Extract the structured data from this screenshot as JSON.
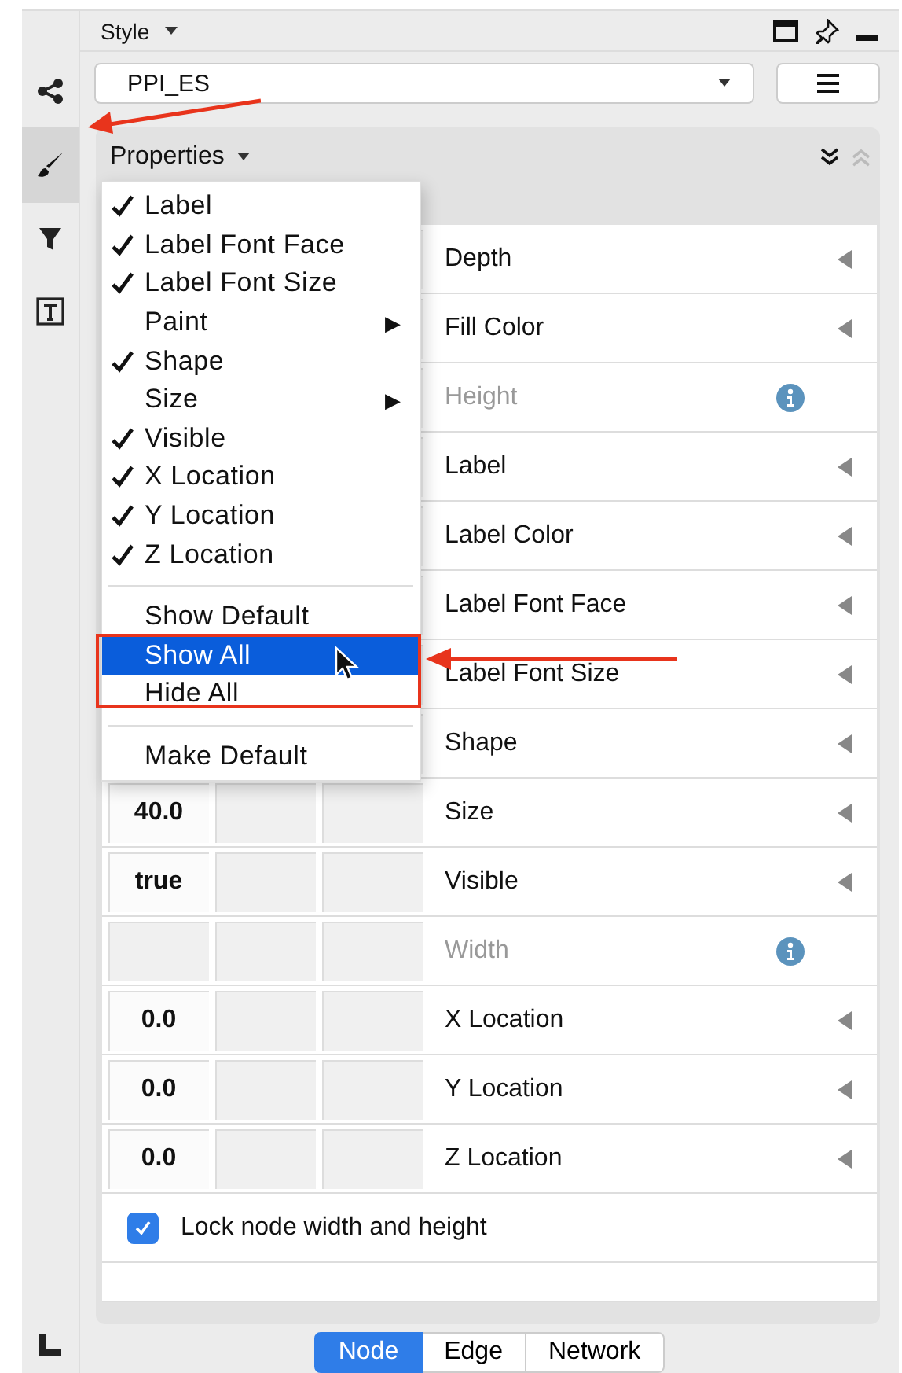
{
  "sidebar": {
    "items": [
      {
        "selected": false
      },
      {
        "selected": true
      },
      {
        "selected": false
      },
      {
        "selected": false
      }
    ]
  },
  "panel": {
    "title": "Style",
    "style_select": {
      "value": "PPI_ES"
    }
  },
  "properties": {
    "title": "Properties",
    "rows": [
      {
        "name": "Depth",
        "default": "",
        "disabled": false,
        "kind": "arrow"
      },
      {
        "name": "Fill Color",
        "default": "",
        "disabled": false,
        "kind": "arrow"
      },
      {
        "name": "Height",
        "default": "",
        "disabled": true,
        "kind": "info"
      },
      {
        "name": "Label",
        "default": "",
        "disabled": false,
        "kind": "arrow"
      },
      {
        "name": "Label Color",
        "default": "",
        "disabled": false,
        "kind": "arrow"
      },
      {
        "name": "Label Font Face",
        "default": "",
        "disabled": false,
        "kind": "arrow"
      },
      {
        "name": "Label Font Size",
        "default": "",
        "disabled": false,
        "kind": "arrow"
      },
      {
        "name": "Shape",
        "default": "",
        "disabled": false,
        "kind": "arrow"
      },
      {
        "name": "Size",
        "default": "40.0",
        "disabled": false,
        "kind": "arrow"
      },
      {
        "name": "Visible",
        "default": "true",
        "disabled": false,
        "kind": "arrow"
      },
      {
        "name": "Width",
        "default": "",
        "disabled": true,
        "kind": "info"
      },
      {
        "name": "X Location",
        "default": "0.0",
        "disabled": false,
        "kind": "arrow"
      },
      {
        "name": "Y Location",
        "default": "0.0",
        "disabled": false,
        "kind": "arrow"
      },
      {
        "name": "Z Location",
        "default": "0.0",
        "disabled": false,
        "kind": "arrow"
      }
    ],
    "lock_checkbox": {
      "label": "Lock node width and height",
      "checked": true
    }
  },
  "context_menu": {
    "items": [
      {
        "kind": "check",
        "label": "Label",
        "checked": true
      },
      {
        "kind": "check",
        "label": "Label Font Face",
        "checked": true
      },
      {
        "kind": "check",
        "label": "Label Font Size",
        "checked": true
      },
      {
        "kind": "submenu",
        "label": "Paint",
        "arrow": "▶"
      },
      {
        "kind": "check",
        "label": "Shape",
        "checked": true
      },
      {
        "kind": "submenu",
        "label": "Size",
        "arrow": "▶"
      },
      {
        "kind": "check",
        "label": "Visible",
        "checked": true
      },
      {
        "kind": "check",
        "label": "X Location",
        "checked": true
      },
      {
        "kind": "check",
        "label": "Y Location",
        "checked": true
      },
      {
        "kind": "check",
        "label": "Z Location",
        "checked": true
      },
      {
        "kind": "separator"
      },
      {
        "kind": "action",
        "label": "Show Default",
        "selected": false
      },
      {
        "kind": "action",
        "label": "Show All",
        "selected": true
      },
      {
        "kind": "action",
        "label": "Hide All",
        "selected": false
      },
      {
        "kind": "separator"
      },
      {
        "kind": "action",
        "label": "Make Default",
        "selected": false
      }
    ]
  },
  "tabs": [
    {
      "label": "Node",
      "selected": true
    },
    {
      "label": "Edge",
      "selected": false
    },
    {
      "label": "Network",
      "selected": false
    }
  ]
}
